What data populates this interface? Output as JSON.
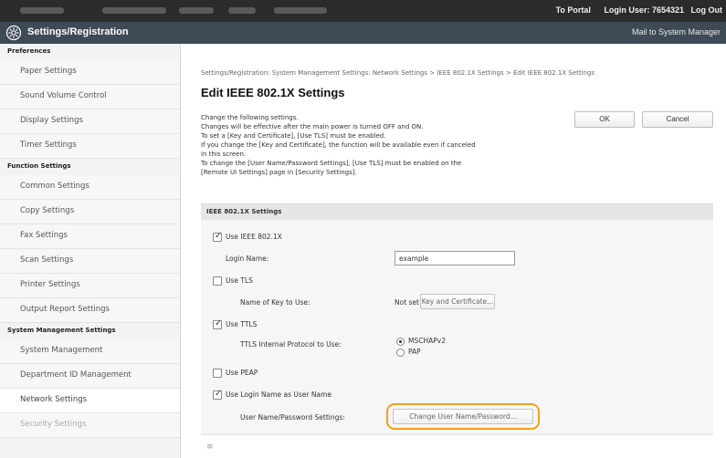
{
  "topbar": {
    "portal_link": "To Portal",
    "login_user": "Login User: 7654321",
    "logout": "Log Out"
  },
  "header": {
    "title": "Settings/Registration",
    "mailto": "Mail to System Manager"
  },
  "sidebar": {
    "groups": [
      {
        "heading": "Preferences",
        "items": [
          "Paper Settings",
          "Sound Volume Control",
          "Display Settings",
          "Timer Settings"
        ]
      },
      {
        "heading": "Function Settings",
        "items": [
          "Common Settings",
          "Copy Settings",
          "Fax Settings",
          "Scan Settings",
          "Printer Settings",
          "Output Report Settings"
        ]
      },
      {
        "heading": "System Management Settings",
        "items": [
          "System Management",
          "Department ID Management",
          "Network Settings",
          "Security Settings"
        ]
      }
    ],
    "active_item": "Network Settings"
  },
  "main": {
    "breadcrumb": "Settings/Registration: System Management Settings: Network Settings > IEEE 802.1X Settings > Edit IEEE 802.1X Settings",
    "title": "Edit IEEE 802.1X Settings",
    "description": [
      "Change the following settings.",
      "Changes will be effective after the main power is turned OFF and ON.",
      "To set a [Key and Certificate], [Use TLS] must be enabled.",
      "If you change the [Key and Certificate], the function will be available even if canceled",
      "in this screen.",
      "To change the [User Name/Password Settings], [Use TLS] must be enabled on the",
      "[Remote UI Settings] page in [Security Settings]."
    ],
    "ok_label": "OK",
    "cancel_label": "Cancel"
  },
  "section": {
    "heading": "IEEE 802.1X Settings",
    "use_ieee_label": "Use IEEE 802.1X",
    "use_ieee_checked": true,
    "login_name_label": "Login Name:",
    "login_name_value": "example",
    "use_tls_label": "Use TLS",
    "use_tls_checked": false,
    "key_name_label": "Name of Key to Use:",
    "key_name_value": "Not set",
    "key_cert_button": "Key and Certificate...",
    "use_ttls_label": "Use TTLS",
    "use_ttls_checked": true,
    "ttls_protocol_label": "TTLS Internal Protocol to Use:",
    "protocol_options": [
      "MSCHAPv2",
      "PAP"
    ],
    "protocol_selected": "MSCHAPv2",
    "use_peap_label": "Use PEAP",
    "use_peap_checked": false,
    "use_login_name_label": "Use Login Name as User Name",
    "use_login_name_checked": true,
    "user_pass_label": "User Name/Password Settings:",
    "change_user_pass_button": "Change User Name/Password..."
  },
  "footer_mark": "≡"
}
